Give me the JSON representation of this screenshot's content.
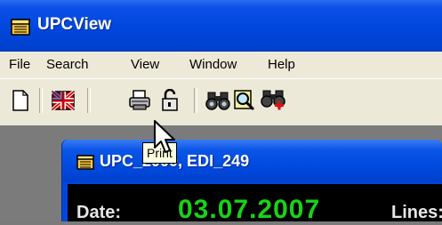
{
  "window": {
    "title": "UPCView",
    "icon": "folder-icon"
  },
  "menu": [
    "File",
    "Search",
    "View",
    "Window",
    "Help"
  ],
  "toolbar": {
    "buttons": [
      {
        "name": "new-document",
        "icon": "blank-page-icon"
      },
      {
        "name": "flag",
        "icon": "flag-icon"
      },
      {
        "name": "print",
        "icon": "printer-icon"
      },
      {
        "name": "lock",
        "icon": "padlock-icon"
      },
      {
        "name": "find",
        "icon": "binoculars-icon"
      },
      {
        "name": "search-file",
        "icon": "magnifier-icon"
      },
      {
        "name": "find-add",
        "icon": "binoculars-plus-icon"
      }
    ]
  },
  "tooltip": {
    "text": "Print"
  },
  "child_window": {
    "title": "UPC_2000, EDI_249",
    "icon": "folder-icon",
    "date_label": "Date:",
    "date_value": "03.07.2007",
    "lines_label": "Lines:"
  },
  "colors": {
    "titlebar": "#0046db",
    "date_value": "#17d417",
    "menubar": "#ece9d8"
  }
}
